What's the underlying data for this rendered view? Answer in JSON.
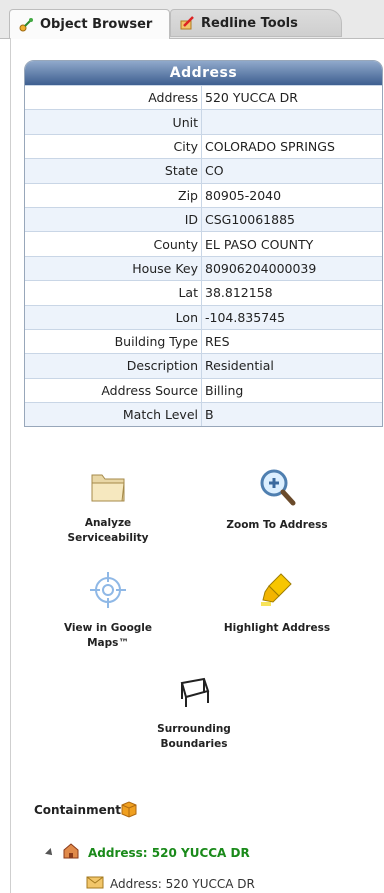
{
  "tabs": [
    {
      "label": "Object Browser",
      "icon": "object-browser-icon",
      "active": true
    },
    {
      "label": "Redline Tools",
      "icon": "redline-tools-icon",
      "active": false
    }
  ],
  "address_panel": {
    "title": "Address",
    "rows": [
      {
        "label": "Address",
        "value": "520 YUCCA DR"
      },
      {
        "label": "Unit",
        "value": ""
      },
      {
        "label": "City",
        "value": "COLORADO SPRINGS"
      },
      {
        "label": "State",
        "value": "CO"
      },
      {
        "label": "Zip",
        "value": "80905-2040"
      },
      {
        "label": "ID",
        "value": "CSG10061885"
      },
      {
        "label": "County",
        "value": "EL PASO COUNTY"
      },
      {
        "label": "House Key",
        "value": "80906204000039"
      },
      {
        "label": "Lat",
        "value": "38.812158"
      },
      {
        "label": "Lon",
        "value": "-104.835745"
      },
      {
        "label": "Building Type",
        "value": "RES"
      },
      {
        "label": "Description",
        "value": "Residential"
      },
      {
        "label": "Address Source",
        "value": "Billing"
      },
      {
        "label": "Match Level",
        "value": "B"
      }
    ]
  },
  "actions": {
    "analyze": {
      "line1": "Analyze",
      "line2": "Serviceability",
      "icon": "folder-icon"
    },
    "zoom": {
      "label": "Zoom To Address",
      "icon": "magnifier-zoom-icon"
    },
    "google": {
      "line1": "View in Google",
      "line2": "Maps™",
      "icon": "crosshair-icon"
    },
    "highlight": {
      "label": "Highlight Address",
      "icon": "highlighter-icon"
    },
    "boundaries": {
      "line1": "Surrounding",
      "line2": "Boundaries",
      "icon": "boundary-icon"
    }
  },
  "containment": {
    "title": "Containment",
    "node": {
      "label": "Address: 520 YUCCA DR"
    },
    "child": {
      "label": "Address: 520 YUCCA DR"
    }
  },
  "colors": {
    "panel_header": "#3e5f90",
    "row_alt": "#edf3fb",
    "tree_green": "#1a8a1a"
  }
}
